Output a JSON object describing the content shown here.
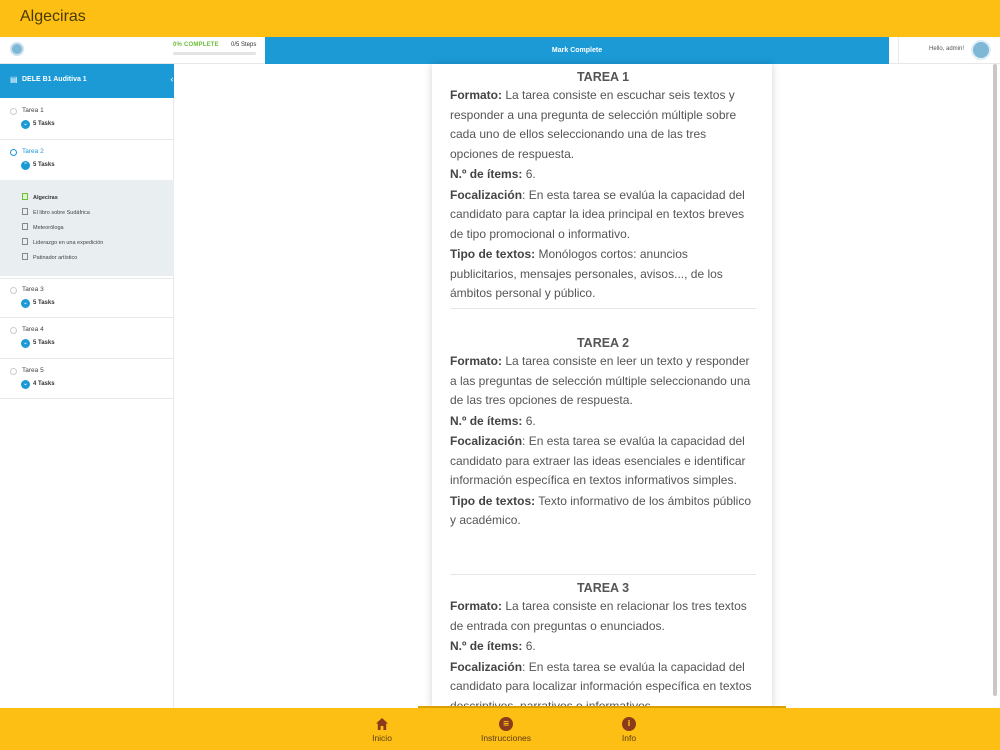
{
  "app": {
    "title": "Algeciras"
  },
  "progress": {
    "percent_label": "0% COMPLETE",
    "steps_label": "0/5 Steps",
    "fraction": 0
  },
  "actions": {
    "mark_complete": "Mark Complete"
  },
  "user": {
    "greeting": "Hello, admin!"
  },
  "sidebar": {
    "course_title": "DELE B1 Auditiva 1",
    "collapse_icon": "chevron-left-icon",
    "sections": [
      {
        "name": "Tarea 1",
        "tasks": "5 Tasks"
      },
      {
        "name": "Tarea 2",
        "tasks": "5 Tasks"
      },
      {
        "name": "Tarea 3",
        "tasks": "5 Tasks"
      },
      {
        "name": "Tarea 4",
        "tasks": "5 Tasks"
      },
      {
        "name": "Tarea 5",
        "tasks": "4 Tasks"
      }
    ],
    "lessons": [
      "Algeciras",
      "El libro sobre Sudáfrica",
      "Meteoróloga",
      "Liderazgo en una expedición",
      "Patinador artístico"
    ]
  },
  "content": {
    "tareas": [
      {
        "title": "TAREA 1",
        "formato_label": "Formato:",
        "formato": " La tarea consiste en escuchar seis textos y responder a una pregunta de selección múltiple sobre cada uno de ellos seleccionando una de las tres opciones de respuesta.",
        "items_label": "N.º de ítems:",
        "items": " 6.",
        "focal_label": "Focalización",
        "focal": ": En esta tarea se evalúa la capacidad del candidato para captar la idea principal en textos breves de tipo promocional o informativo.",
        "tipo_label": "Tipo de textos:",
        "tipo": " Monólogos cortos: anuncios publicitarios, mensajes personales, avisos..., de los ámbitos personal y público."
      },
      {
        "title": "TAREA 2",
        "formato_label": "Formato:",
        "formato": " La tarea consiste en leer un texto y responder a las preguntas de selección múltiple seleccionando una de las tres opciones de respuesta.",
        "items_label": "N.º de ítems:",
        "items": " 6.",
        "focal_label": "Focalización",
        "focal": ": En esta tarea se evalúa la capacidad del candidato para extraer las ideas esenciales e identificar información específica en textos informativos simples.",
        "tipo_label": "Tipo de textos:",
        "tipo": " Texto informativo de los ámbitos público y académico."
      },
      {
        "title": "TAREA 3",
        "formato_label": "Formato:",
        "formato": " La tarea consiste en relacionar los tres textos de entrada con preguntas o enunciados.",
        "items_label": "N.º de ítems:",
        "items": " 6.",
        "focal_label": "Focalización",
        "focal": ": En esta tarea se evalúa la capacidad del candidato para localizar información específica en textos descriptivos, narrativos o informativos."
      }
    ]
  },
  "bottom_nav": [
    {
      "label": "Inicio",
      "icon": "home-icon"
    },
    {
      "label": "Instrucciones",
      "icon": "list-icon"
    },
    {
      "label": "Info",
      "icon": "info-icon"
    }
  ],
  "colors": {
    "accent_yellow": "#fdbf14",
    "primary_blue": "#1b9ad6",
    "progress_green": "#6bbf3a"
  }
}
